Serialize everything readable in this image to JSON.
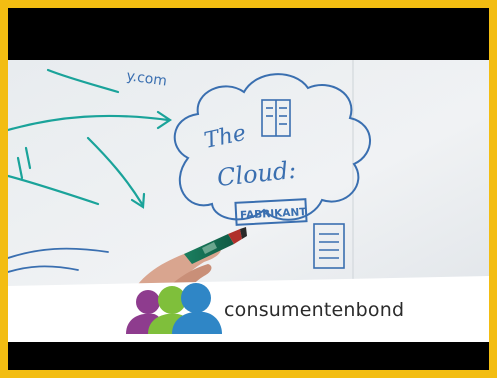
{
  "thumbnail": {
    "whiteboard_text": {
      "title_line1": "The",
      "title_line2": "Cloud:",
      "box_label": "FABRIKANT",
      "partial_text": "y.com"
    }
  },
  "brand": {
    "name": "consumentenbond"
  },
  "colors": {
    "border": "#f3bd12",
    "bar": "#000000",
    "ink_blue": "#3a6fb0",
    "ink_teal": "#1aa39a",
    "logo_purple": "#8e3c8e",
    "logo_green": "#7fbf3b",
    "logo_blue": "#2f86c6"
  }
}
